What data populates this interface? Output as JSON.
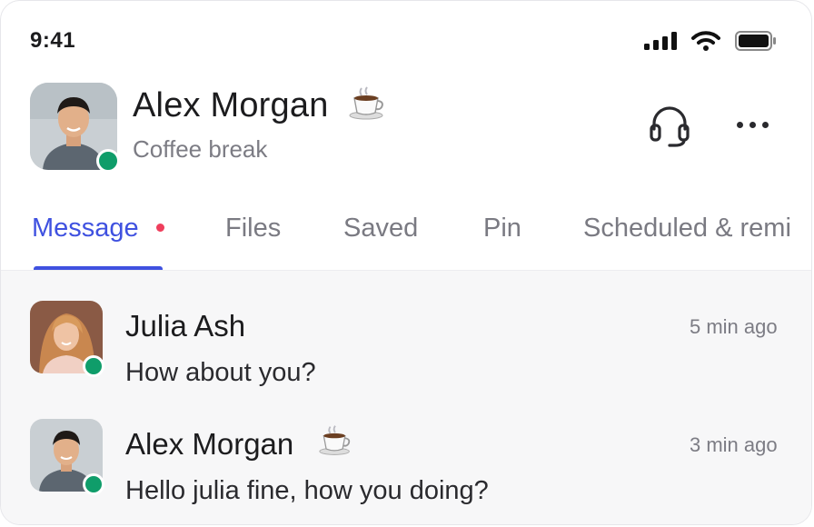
{
  "status_bar": {
    "time": "9:41"
  },
  "header": {
    "name": "Alex Morgan",
    "status_emoji": "coffee-icon",
    "status_text": "Coffee break",
    "presence": "online"
  },
  "tabs": [
    {
      "label": "Message",
      "active": true,
      "has_badge": true
    },
    {
      "label": "Files",
      "active": false
    },
    {
      "label": "Saved",
      "active": false
    },
    {
      "label": "Pin",
      "active": false
    },
    {
      "label": "Scheduled & remi",
      "active": false
    }
  ],
  "messages": [
    {
      "sender": "Julia Ash",
      "text": "How about you?",
      "time": "5 min ago",
      "has_emoji": false
    },
    {
      "sender": "Alex Morgan",
      "text": "Hello julia fine, how you doing?",
      "time": "3 min ago",
      "has_emoji": true
    }
  ],
  "colors": {
    "accent": "#3f51e0",
    "online": "#0f9d6a",
    "badge": "#ef3e5c"
  }
}
